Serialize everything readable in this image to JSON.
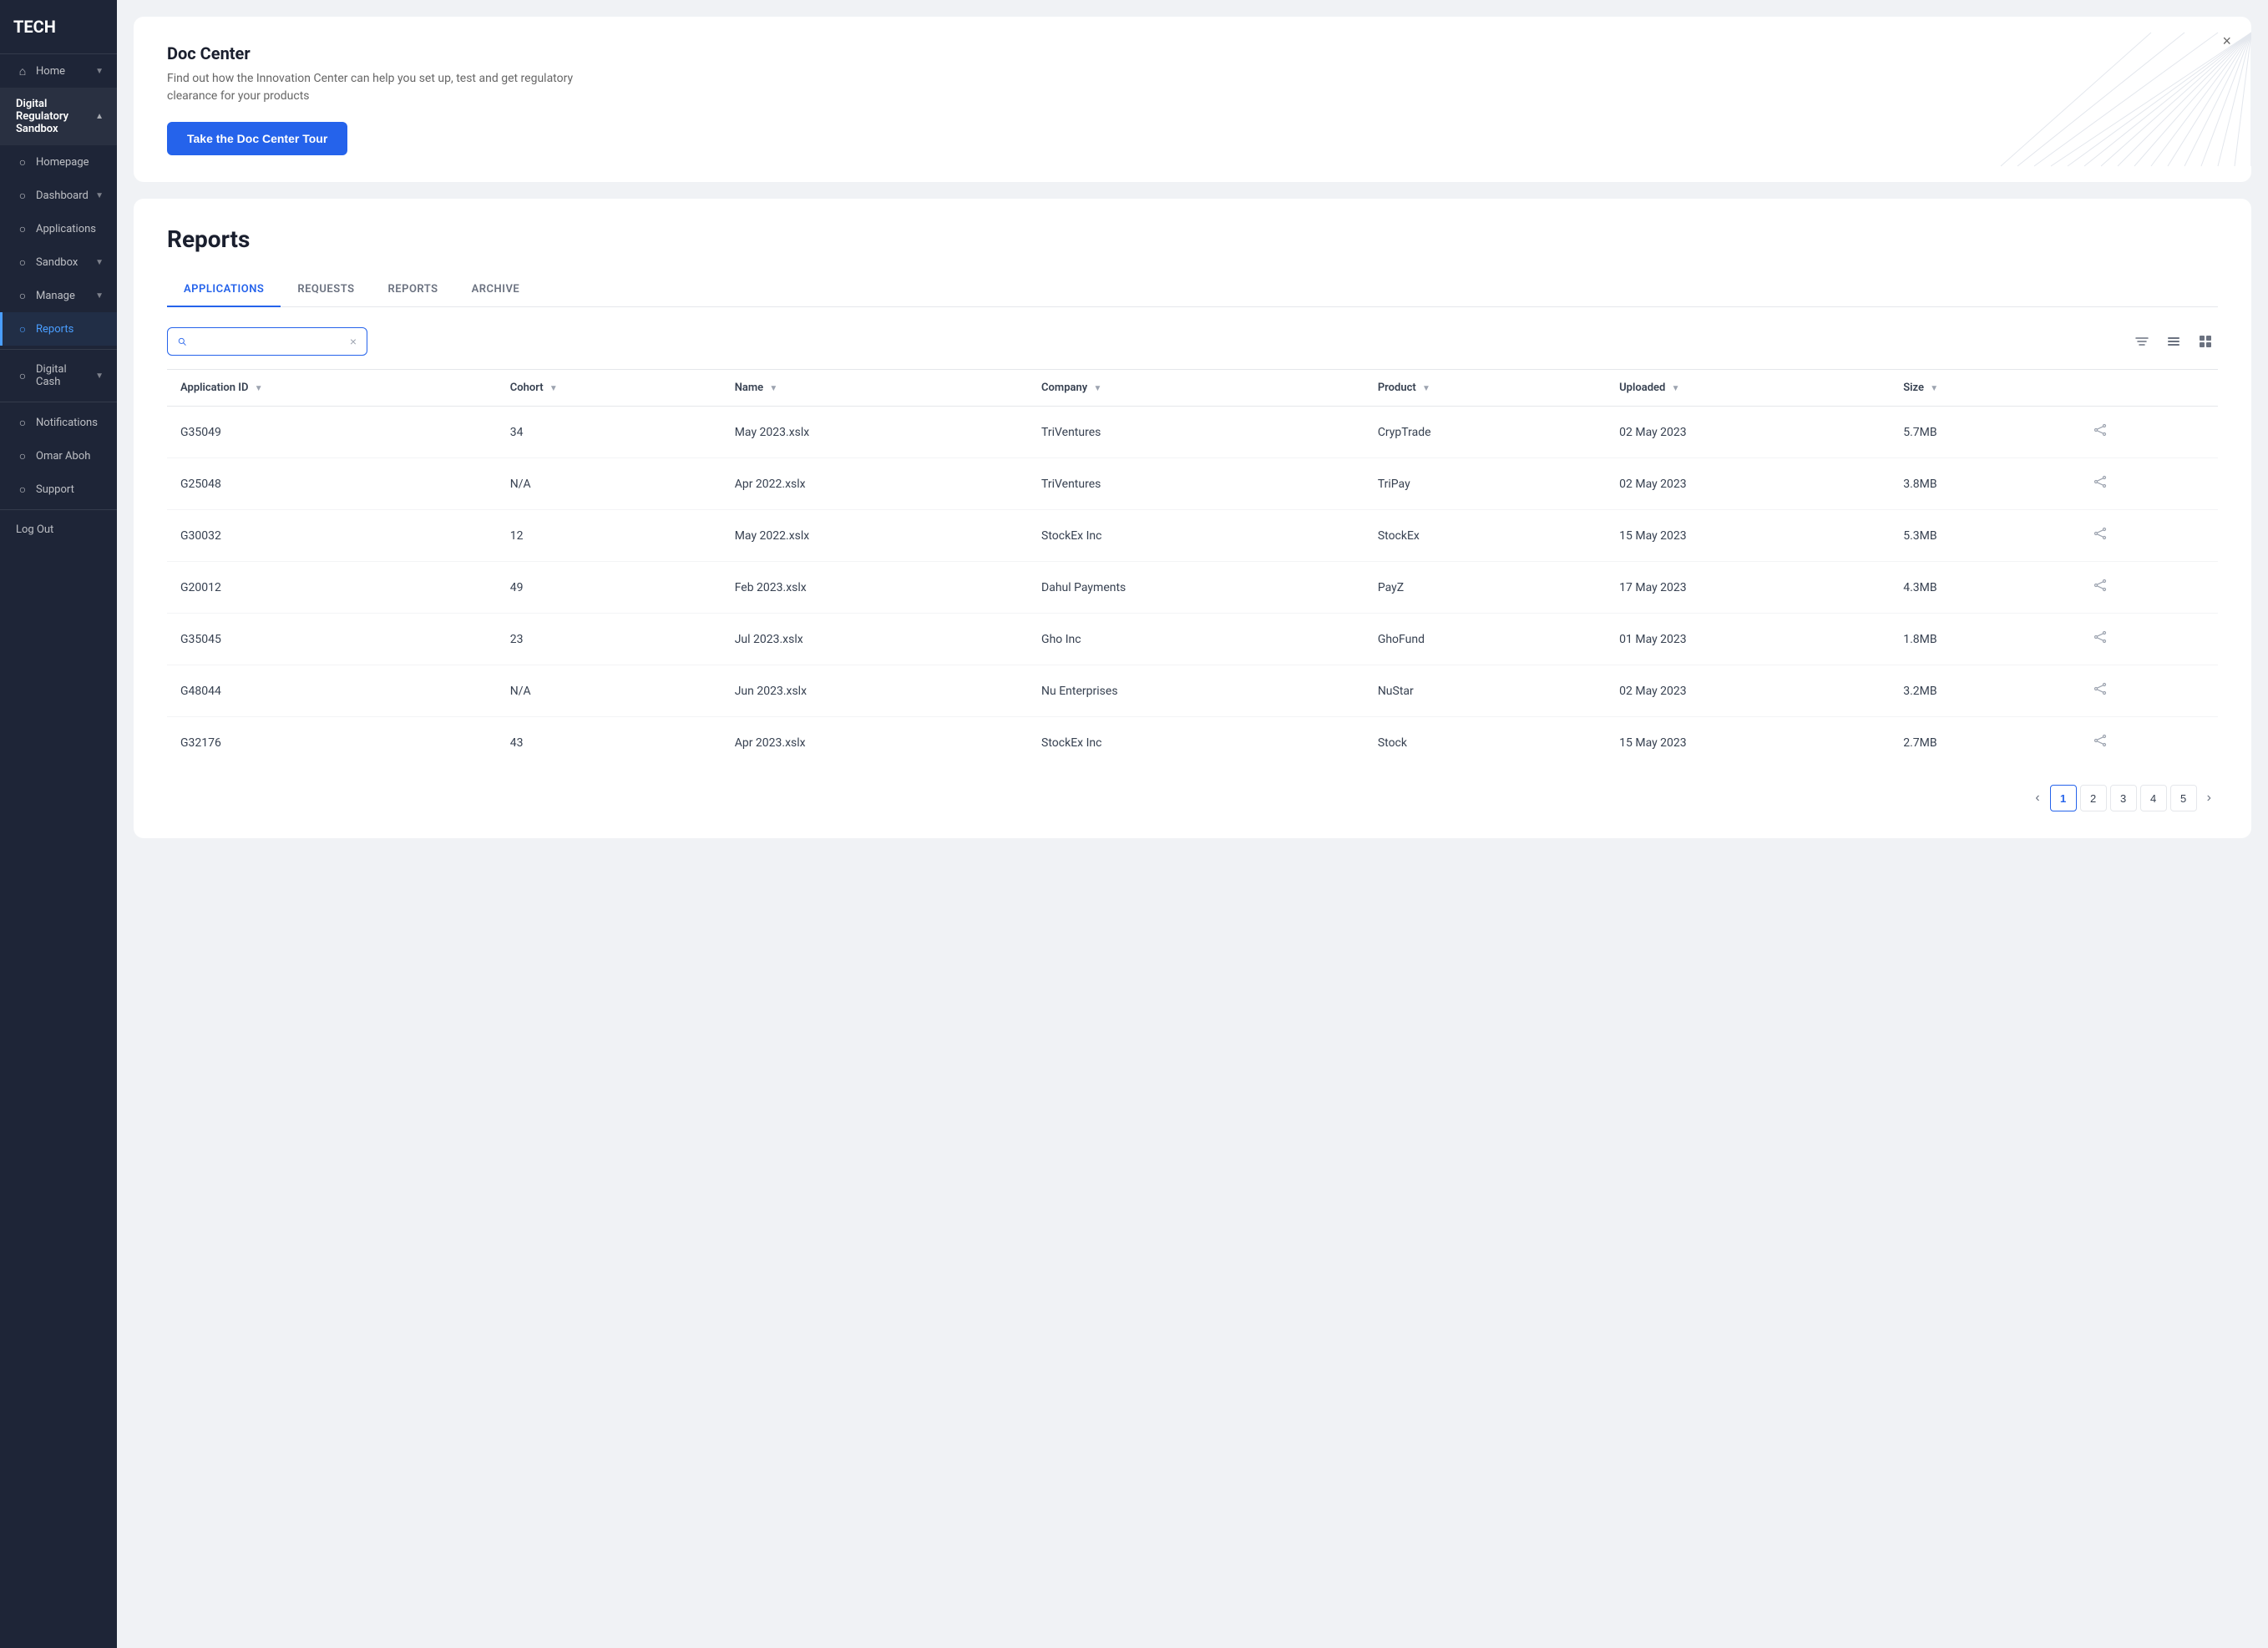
{
  "sidebar": {
    "logo": "TECH",
    "items": [
      {
        "id": "home",
        "label": "Home",
        "icon": "🏠",
        "hasChevron": true,
        "active": false
      },
      {
        "id": "digital-regulatory-sandbox",
        "label": "Digital Regulatory Sandbox",
        "icon": "",
        "hasChevron": true,
        "isSection": true
      },
      {
        "id": "homepage",
        "label": "Homepage",
        "icon": "○",
        "hasChevron": false,
        "active": false,
        "indent": true
      },
      {
        "id": "dashboard",
        "label": "Dashboard",
        "icon": "○",
        "hasChevron": true,
        "active": false,
        "indent": true
      },
      {
        "id": "applications",
        "label": "Applications",
        "icon": "○",
        "hasChevron": false,
        "active": false,
        "indent": true
      },
      {
        "id": "sandbox",
        "label": "Sandbox",
        "icon": "○",
        "hasChevron": true,
        "active": false,
        "indent": true
      },
      {
        "id": "manage",
        "label": "Manage",
        "icon": "○",
        "hasChevron": true,
        "active": false,
        "indent": true
      },
      {
        "id": "reports",
        "label": "Reports",
        "icon": "○",
        "hasChevron": false,
        "active": true,
        "indent": true
      },
      {
        "id": "digital-cash",
        "label": "Digital Cash",
        "icon": "",
        "hasChevron": true,
        "isSection": false
      },
      {
        "id": "notifications",
        "label": "Notifications",
        "icon": "○",
        "hasChevron": false,
        "active": false
      },
      {
        "id": "user",
        "label": "Omar Aboh",
        "icon": "○",
        "hasChevron": false,
        "active": false
      },
      {
        "id": "support",
        "label": "Support",
        "icon": "○",
        "hasChevron": false,
        "active": false
      },
      {
        "id": "logout",
        "label": "Log Out",
        "icon": "",
        "hasChevron": false,
        "active": false
      }
    ]
  },
  "banner": {
    "title": "Doc Center",
    "subtitle": "Find out how the Innovation Center can help you set up, test and get regulatory clearance for your products",
    "button_label": "Take the Doc Center Tour",
    "close_label": "×"
  },
  "reports": {
    "title": "Reports",
    "tabs": [
      {
        "id": "applications",
        "label": "APPLICATIONS",
        "active": true
      },
      {
        "id": "requests",
        "label": "REQUESTS",
        "active": false
      },
      {
        "id": "reports",
        "label": "REPORTS",
        "active": false
      },
      {
        "id": "archive",
        "label": "ARCHIVE",
        "active": false
      }
    ],
    "search": {
      "placeholder": "",
      "value": ""
    },
    "table": {
      "columns": [
        {
          "id": "app-id",
          "label": "Application ID"
        },
        {
          "id": "cohort",
          "label": "Cohort"
        },
        {
          "id": "name",
          "label": "Name"
        },
        {
          "id": "company",
          "label": "Company"
        },
        {
          "id": "product",
          "label": "Product"
        },
        {
          "id": "uploaded",
          "label": "Uploaded"
        },
        {
          "id": "size",
          "label": "Size"
        }
      ],
      "rows": [
        {
          "app_id": "G35049",
          "cohort": "34",
          "name": "May 2023.xslx",
          "company": "TriVentures",
          "product": "CrypTrade",
          "uploaded": "02 May 2023",
          "size": "5.7MB"
        },
        {
          "app_id": "G25048",
          "cohort": "N/A",
          "name": "Apr 2022.xslx",
          "company": "TriVentures",
          "product": "TriPay",
          "uploaded": "02 May 2023",
          "size": "3.8MB"
        },
        {
          "app_id": "G30032",
          "cohort": "12",
          "name": "May 2022.xslx",
          "company": "StockEx Inc",
          "product": "StockEx",
          "uploaded": "15 May 2023",
          "size": "5.3MB"
        },
        {
          "app_id": "G20012",
          "cohort": "49",
          "name": "Feb 2023.xslx",
          "company": "Dahul Payments",
          "product": "PayZ",
          "uploaded": "17 May 2023",
          "size": "4.3MB"
        },
        {
          "app_id": "G35045",
          "cohort": "23",
          "name": "Jul 2023.xslx",
          "company": "Gho Inc",
          "product": "GhoFund",
          "uploaded": "01 May 2023",
          "size": "1.8MB"
        },
        {
          "app_id": "G48044",
          "cohort": "N/A",
          "name": "Jun 2023.xslx",
          "company": "Nu Enterprises",
          "product": "NuStar",
          "uploaded": "02 May 2023",
          "size": "3.2MB"
        },
        {
          "app_id": "G32176",
          "cohort": "43",
          "name": "Apr 2023.xslx",
          "company": "StockEx Inc",
          "product": "Stock",
          "uploaded": "15 May 2023",
          "size": "2.7MB"
        }
      ]
    },
    "pagination": {
      "current": 1,
      "pages": [
        1,
        2,
        3,
        4,
        5
      ]
    }
  }
}
